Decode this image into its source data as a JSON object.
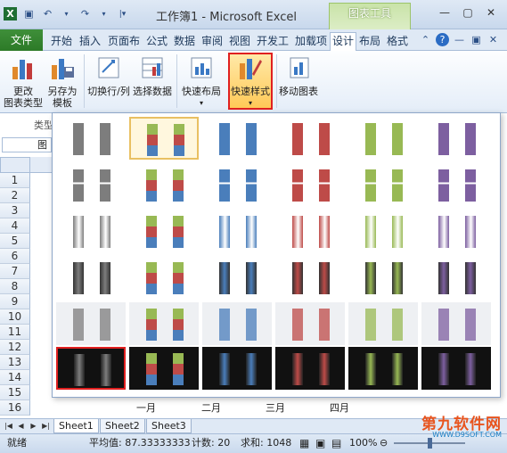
{
  "app": {
    "title": "工作簿1 - Microsoft Excel",
    "context_group": "图表工具"
  },
  "tabs": [
    "文件",
    "开始",
    "插入",
    "页面布",
    "公式",
    "数据",
    "审阅",
    "视图",
    "开发工",
    "加载项",
    "设计",
    "布局",
    "格式"
  ],
  "ribbon": {
    "change_type": "更改\n图表类型",
    "save_template": "另存为\n模板",
    "switch_rowcol": "切换行/列",
    "select_data": "选择数据",
    "quick_layout": "快速布局",
    "quick_style": "快速样式",
    "move_chart": "移动图表",
    "group_type": "类型"
  },
  "namebox": "图",
  "rows": [
    "1",
    "2",
    "3",
    "4",
    "5",
    "6",
    "7",
    "8",
    "9",
    "10",
    "11",
    "12",
    "13",
    "14",
    "15",
    "16"
  ],
  "axis_labels": [
    "一月",
    "二月",
    "三月",
    "四月"
  ],
  "sheets": [
    "Sheet1",
    "Sheet2",
    "Sheet3"
  ],
  "status": {
    "ready": "就绪",
    "average": "平均值: 87.33333333",
    "count": "计数: 20",
    "sum": "求和: 1048",
    "zoom": "100%"
  },
  "watermark": {
    "line1": "第九软件网",
    "line2": "WWW.D9SOFT.COM"
  },
  "colors": {
    "gray": "#7d7d7d",
    "blue": "#4a7ebb",
    "red": "#be4b48",
    "green": "#98b954",
    "purple": "#7d5fa0",
    "accent_file": "#2c7a27"
  }
}
